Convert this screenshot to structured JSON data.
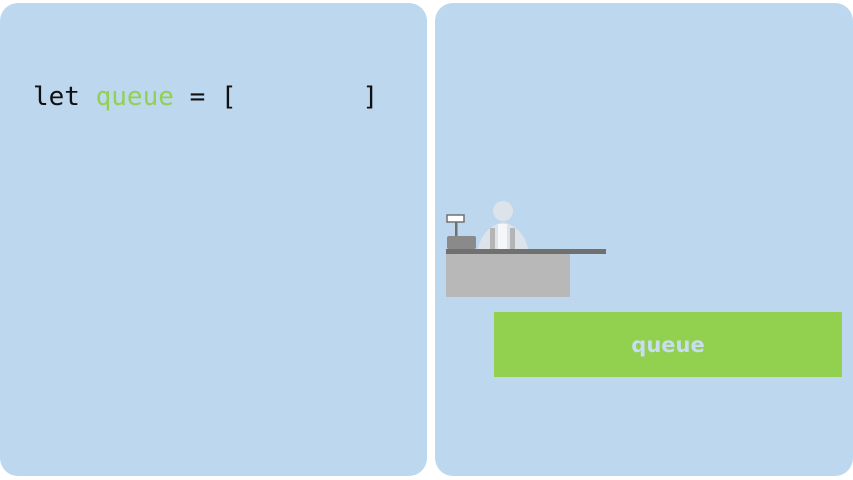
{
  "code": {
    "keyword": "let",
    "variable": "queue",
    "operator": "=",
    "open_bracket": "[",
    "close_bracket": "]"
  },
  "queue_box": {
    "label": "queue"
  },
  "colors": {
    "panel_background": "#bdd7ee",
    "queue_green": "#92d050",
    "queue_label": "#c8ddf0",
    "counter_top": "#707070",
    "counter_front": "#b8b8b8",
    "register": "#8a8a8a",
    "cashier_head": "#dde3ea"
  },
  "icons": {
    "cashier": "cashier-person-icon",
    "register": "cash-register-icon",
    "counter": "counter-desk-icon"
  }
}
